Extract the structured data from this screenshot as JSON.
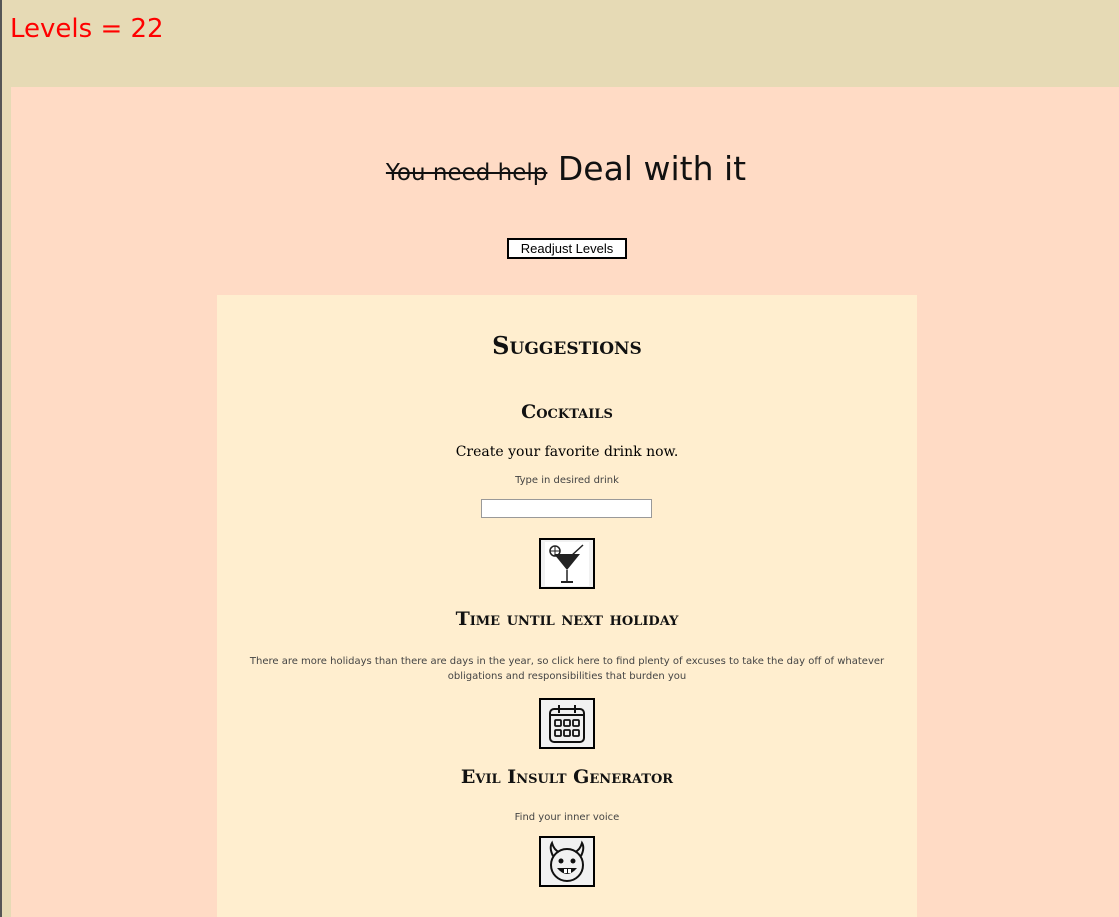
{
  "levels_label": "Levels = 22",
  "headline": {
    "struck": "You need help",
    "main": "Deal with it"
  },
  "readjust_button": "Readjust Levels",
  "suggestions": {
    "title": "Suggestions",
    "cocktails": {
      "title": "Cocktails",
      "subtitle": "Create your favorite drink now.",
      "label": "Type in desired drink",
      "input_value": "",
      "icon": "cocktail-icon"
    },
    "holiday": {
      "title": "Time until next holiday",
      "description": "There are more holidays than there are days in the year, so click here to find plenty of excuses to take the day off of whatever obligations and responsibilities that burden you",
      "icon": "calendar-icon"
    },
    "insult": {
      "title": "Evil Insult Generator",
      "description": "Find your inner voice",
      "icon": "devil-face-icon"
    }
  }
}
